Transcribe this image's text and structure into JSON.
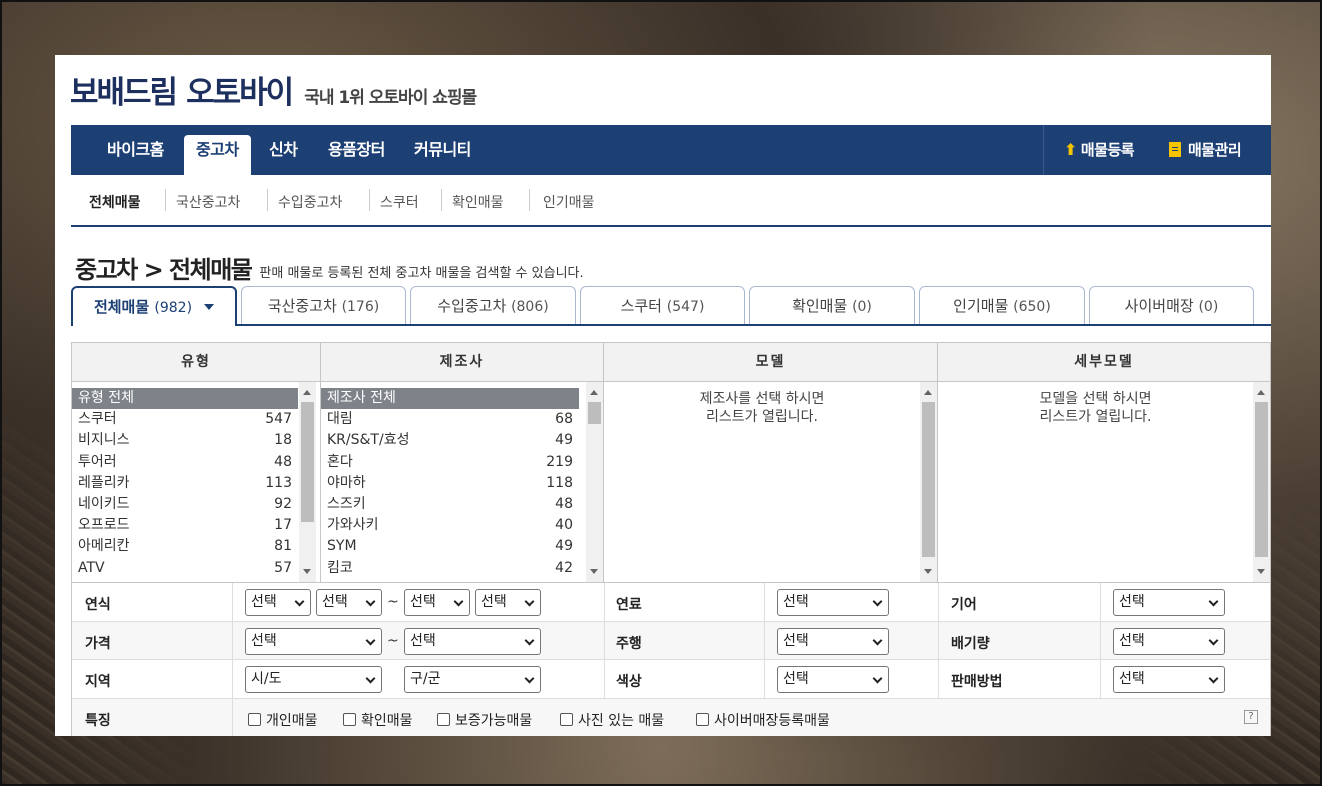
{
  "logo": {
    "brand": "보배드림",
    "name": "오토바이",
    "tagline": "국내 1위 오토바이 쇼핑몰"
  },
  "nav": {
    "items": [
      "바이크홈",
      "중고차",
      "신차",
      "용품장터",
      "커뮤니티"
    ],
    "active": "중고차",
    "register_label": "매물등록",
    "manage_label": "매물관리"
  },
  "subnav": [
    "전체매물",
    "국산중고차",
    "수입중고차",
    "스쿠터",
    "확인매물",
    "인기매물"
  ],
  "heading": {
    "title": "중고차 > 전체매물",
    "desc": "판매 매물로 등록된 전체 중고차 매물을 검색할 수 있습니다."
  },
  "tabs": [
    {
      "label": "전체매물",
      "count": "(982)"
    },
    {
      "label": "국산중고차",
      "count": "(176)"
    },
    {
      "label": "수입중고차",
      "count": "(806)"
    },
    {
      "label": "스쿠터",
      "count": "(547)"
    },
    {
      "label": "확인매물",
      "count": "(0)"
    },
    {
      "label": "인기매물",
      "count": "(650)"
    },
    {
      "label": "사이버매장",
      "count": "(0)"
    }
  ],
  "filter": {
    "headers": [
      "유형",
      "제조사",
      "모델",
      "세부모델"
    ],
    "types": [
      {
        "name": "유형 전체",
        "count": ""
      },
      {
        "name": "스쿠터",
        "count": "547"
      },
      {
        "name": "비지니스",
        "count": "18"
      },
      {
        "name": "투어러",
        "count": "48"
      },
      {
        "name": "레플리카",
        "count": "113"
      },
      {
        "name": "네이키드",
        "count": "92"
      },
      {
        "name": "오프로드",
        "count": "17"
      },
      {
        "name": "아메리칸",
        "count": "81"
      },
      {
        "name": "ATV",
        "count": "57"
      }
    ],
    "makers": [
      {
        "name": "제조사 전체",
        "count": ""
      },
      {
        "name": "대림",
        "count": "68"
      },
      {
        "name": "KR/S&T/효성",
        "count": "49"
      },
      {
        "name": "혼다",
        "count": "219"
      },
      {
        "name": "야마하",
        "count": "118"
      },
      {
        "name": "스즈키",
        "count": "48"
      },
      {
        "name": "가와사키",
        "count": "40"
      },
      {
        "name": "SYM",
        "count": "49"
      },
      {
        "name": "킴코",
        "count": "42"
      }
    ],
    "model_placeholder_1": "제조사를 선택 하시면",
    "model_placeholder_2": "리스트가 열립니다.",
    "submodel_placeholder_1": "모델을 선택 하시면",
    "submodel_placeholder_2": "리스트가 열립니다."
  },
  "rows": {
    "year": {
      "label": "연식",
      "from_year": "선택",
      "from_month": "선택",
      "tilde": "~",
      "to_year": "선택",
      "to_month": "선택"
    },
    "fuel": {
      "label": "연료",
      "value": "선택"
    },
    "gear": {
      "label": "기어",
      "value": "선택"
    },
    "price": {
      "label": "가격",
      "from": "선택",
      "tilde": "~",
      "to": "선택"
    },
    "mileage": {
      "label": "주행",
      "value": "선택"
    },
    "displacement": {
      "label": "배기량",
      "value": "선택"
    },
    "region": {
      "label": "지역",
      "city": "시/도",
      "district": "구/군"
    },
    "color": {
      "label": "색상",
      "value": "선택"
    },
    "sale_method": {
      "label": "판매방법",
      "value": "선택"
    },
    "features": {
      "label": "특징",
      "options": [
        "개인매물",
        "확인매물",
        "보증가능매물",
        "사진 있는 매물",
        "사이버매장등록매물"
      ]
    },
    "help": "?"
  }
}
